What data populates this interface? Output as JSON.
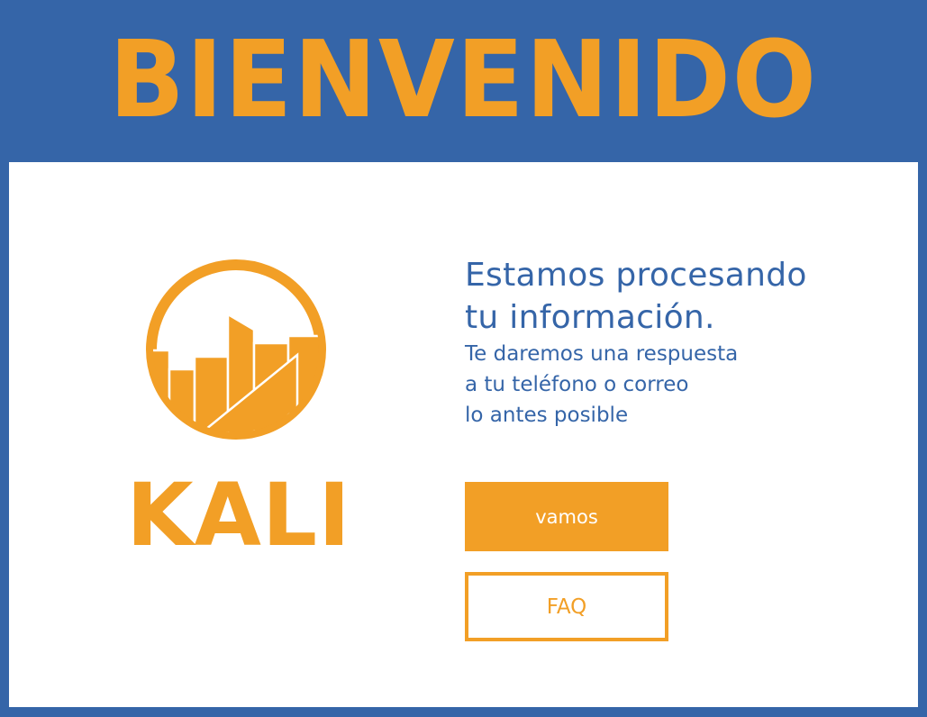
{
  "header": {
    "title": "BIENVENIDO"
  },
  "brand": {
    "name": "KALI",
    "logo_icon": "city-skyline-circle-icon"
  },
  "message": {
    "heading_line1": "Estamos procesando",
    "heading_line2": "tu información.",
    "body_line1": "Te daremos una respuesta",
    "body_line2": "a tu teléfono o correo",
    "body_line3": "lo antes posible"
  },
  "actions": {
    "primary_label": "vamos",
    "secondary_label": "FAQ"
  },
  "colors": {
    "brand_blue": "#3565a8",
    "accent_orange": "#f29f26",
    "card_bg": "#ffffff"
  }
}
